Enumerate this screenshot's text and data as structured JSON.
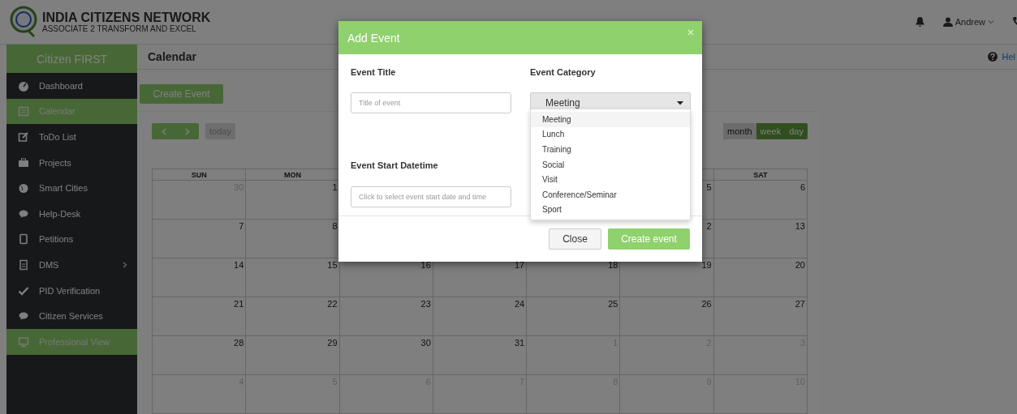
{
  "header": {
    "brand_title": "INDIA CITIZENS NETWORK",
    "brand_subtitle": "ASSOCIATE 2 TRANSFORM AND EXCEL",
    "user_name": "Andrew"
  },
  "sidebar": {
    "title": "Citizen FIRST",
    "items": [
      {
        "label": "Dashboard",
        "selected": false,
        "expandable": false
      },
      {
        "label": "Calendar",
        "selected": true,
        "expandable": false
      },
      {
        "label": "ToDo List",
        "selected": false,
        "expandable": false
      },
      {
        "label": "Projects",
        "selected": false,
        "expandable": false
      },
      {
        "label": "Smart Cities",
        "selected": false,
        "expandable": false
      },
      {
        "label": "Help-Desk",
        "selected": false,
        "expandable": false
      },
      {
        "label": "Petitions",
        "selected": false,
        "expandable": false
      },
      {
        "label": "DMS",
        "selected": false,
        "expandable": true
      },
      {
        "label": "PID Verification",
        "selected": false,
        "expandable": false
      },
      {
        "label": "Citizen Services",
        "selected": false,
        "expandable": false
      },
      {
        "label": "Professional View",
        "selected": true,
        "expandable": false
      }
    ]
  },
  "page": {
    "title": "Calendar",
    "help_link": "Hel",
    "create_button": "Create Event"
  },
  "calendar": {
    "today_button": "today",
    "views": [
      {
        "label": "month",
        "selected": true
      },
      {
        "label": "week",
        "selected": false
      },
      {
        "label": "day",
        "selected": false
      }
    ],
    "weekdays_left": [
      "SUN",
      "MON"
    ],
    "weekdays_right": [
      "SAT"
    ],
    "weeks": [
      {
        "cells_left": [
          {
            "day": "30",
            "muted": true
          },
          {
            "day": "1",
            "muted": false
          }
        ],
        "cells_right": [
          {
            "day": "5",
            "muted": false
          },
          {
            "day": "6",
            "muted": false
          }
        ]
      },
      {
        "cells_left": [
          {
            "day": "7",
            "muted": false
          },
          {
            "day": "8",
            "muted": false
          }
        ],
        "cells_right": [
          {
            "day": "2",
            "muted": false
          },
          {
            "day": "13",
            "muted": false
          }
        ]
      },
      {
        "cells_left": [
          {
            "day": "14",
            "muted": false
          },
          {
            "day": "15",
            "muted": false
          },
          {
            "day": "16",
            "muted": false
          },
          {
            "day": "17",
            "muted": false
          },
          {
            "day": "18",
            "muted": false
          },
          {
            "day": "19",
            "muted": false
          },
          {
            "day": "20",
            "muted": false
          }
        ]
      },
      {
        "cells_left": [
          {
            "day": "21",
            "muted": false
          },
          {
            "day": "22",
            "muted": false
          },
          {
            "day": "23",
            "muted": false
          },
          {
            "day": "24",
            "muted": false
          },
          {
            "day": "25",
            "muted": false
          },
          {
            "day": "26",
            "muted": false
          },
          {
            "day": "27",
            "muted": false
          }
        ]
      },
      {
        "cells_left": [
          {
            "day": "28",
            "muted": false
          },
          {
            "day": "29",
            "muted": false
          },
          {
            "day": "30",
            "muted": false
          },
          {
            "day": "31",
            "muted": false
          },
          {
            "day": "1",
            "muted": true
          },
          {
            "day": "2",
            "muted": true
          },
          {
            "day": "3",
            "muted": true
          }
        ]
      },
      {
        "cells_left": [
          {
            "day": "4",
            "muted": true
          },
          {
            "day": "5",
            "muted": true
          },
          {
            "day": "6",
            "muted": true
          },
          {
            "day": "7",
            "muted": true
          },
          {
            "day": "8",
            "muted": true
          },
          {
            "day": "9",
            "muted": true
          },
          {
            "day": "10",
            "muted": true
          }
        ]
      }
    ]
  },
  "modal": {
    "title": "Add Event",
    "event_title": {
      "label": "Event Title",
      "placeholder": "Title of event"
    },
    "event_category": {
      "label": "Event Category",
      "value": "Meeting",
      "expanded": true,
      "options": [
        {
          "label": "Meeting",
          "selected": true
        },
        {
          "label": "Lunch",
          "selected": false
        },
        {
          "label": "Training",
          "selected": false
        },
        {
          "label": "Social",
          "selected": false
        },
        {
          "label": "Visit",
          "selected": false
        },
        {
          "label": "Conference/Seminar",
          "selected": false
        },
        {
          "label": "Sport",
          "selected": false
        }
      ]
    },
    "event_start": {
      "label": "Event Start Datetime",
      "placeholder": "Click to select event start date and time"
    },
    "buttons": {
      "close": "Close",
      "create": "Create event"
    }
  }
}
